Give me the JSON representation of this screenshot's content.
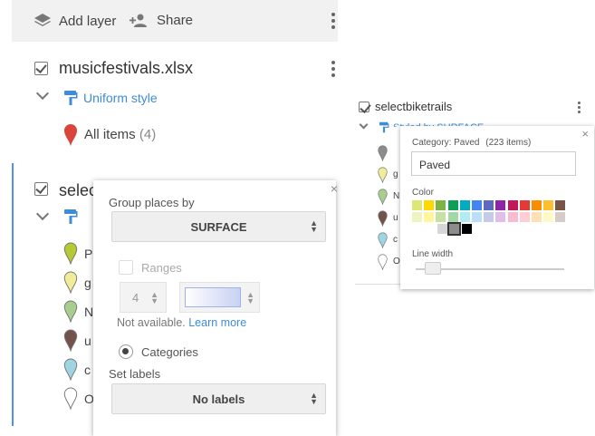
{
  "toolbar": {
    "add_layer": "Add layer",
    "share": "Share"
  },
  "layer1": {
    "title": "musicfestivals.xlsx",
    "style_link": "Uniform style",
    "all_items_label": "All items",
    "all_items_count": "(4)",
    "pin_color": "#d9453b"
  },
  "layer2": {
    "title": "selec",
    "items": [
      {
        "label": "P",
        "color": "#b6c832"
      },
      {
        "label": "g",
        "color": "#f0ec98"
      },
      {
        "label": "N",
        "color": "#a8cd8f"
      },
      {
        "label": "u",
        "color": "#74524c"
      },
      {
        "label": "c",
        "color": "#9fd5e1"
      },
      {
        "label": "O",
        "color": "#ffffff"
      }
    ]
  },
  "group_popup": {
    "group_by_label": "Group places by",
    "group_by_value": "SURFACE",
    "ranges_label": "Ranges",
    "range_count": "4",
    "not_available": "Not available.",
    "learn_more": "Learn more",
    "categories_label": "Categories",
    "set_labels_label": "Set labels",
    "set_labels_value": "No labels",
    "close": "×"
  },
  "right_panel": {
    "title": "selectbiketrails",
    "style_link": "Styled by SURFACE",
    "items": [
      {
        "label": "",
        "color": "#8c8c8c"
      },
      {
        "label": "g",
        "color": "#f0ec98"
      },
      {
        "label": "N",
        "color": "#a8cd8f"
      },
      {
        "label": "u",
        "color": "#74524c"
      },
      {
        "label": "c",
        "color": "#9fd5e1"
      },
      {
        "label": "O",
        "color": "#ffffff"
      }
    ]
  },
  "category_popup": {
    "category_text": "Category: Paved",
    "items_count": "(223 items)",
    "name_value": "Paved",
    "color_label": "Color",
    "line_width_label": "Line width",
    "close": "×",
    "palette_row1": [
      "#dce775",
      "#fbd800",
      "#7cb342",
      "#0f9d58",
      "#00acc1",
      "#4285f4",
      "#5c6bc0",
      "#8e24aa",
      "#c2185b",
      "#e53935",
      "#fb8c00",
      "#fbc02d",
      "#795548"
    ],
    "palette_row2": [
      "#f0f4c3",
      "#fff59d",
      "#c5e1a5",
      "#a5d6a7",
      "#b2ebf2",
      "#bbdefb",
      "#c5cae9",
      "#e1bee7",
      "#f8bbd0",
      "#ffcdd2",
      "#ffe0b2",
      "#fff9c4",
      "#d7ccc8"
    ],
    "palette_row3": [
      "#ffffff",
      "#d6d6d6",
      "#8c8c8c",
      "#000000"
    ],
    "selected_color": "#8c8c8c"
  }
}
